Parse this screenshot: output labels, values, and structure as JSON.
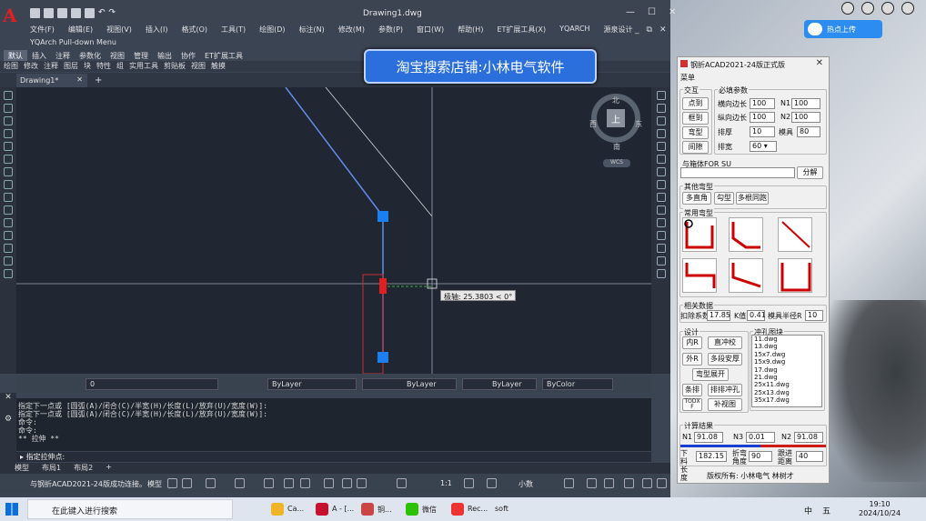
{
  "autocad": {
    "title": "Drawing1.dwg",
    "menus": [
      "文件(F)",
      "编辑(E)",
      "视图(V)",
      "插入(I)",
      "格式(O)",
      "工具(T)",
      "绘图(D)",
      "标注(N)",
      "修改(M)",
      "参数(P)",
      "窗口(W)",
      "帮助(H)",
      "ET扩展工具(X)",
      "YQARCH",
      "源泉设计"
    ],
    "yqarch_menu": "YQArch Pull-down Menu",
    "ribbon_tabs": [
      "默认",
      "插入",
      "注释",
      "参数化",
      "视图",
      "管理",
      "输出",
      "协作",
      "ET扩展工具"
    ],
    "ribbon_panel": [
      "绘图",
      "修改",
      "注释",
      "图层",
      "块",
      "特性",
      "组",
      "实用工具",
      "剪贴板",
      "视图",
      "触摸"
    ],
    "doc_tab": "Drawing1*",
    "promo": "淘宝搜索店铺:小林电气软件",
    "viewcube": {
      "n": "北",
      "s": "南",
      "w": "西",
      "e": "东",
      "top": "上",
      "wcs": "WCS"
    },
    "tooltip": "极轴: 25.3803 < 0°",
    "properties": {
      "layer": "0",
      "color": "ByLayer",
      "linetype": "ByLayer",
      "lineweight": "ByLayer",
      "plotstyle": "ByColor"
    },
    "command_history": [
      "指定下一点或 [圆弧(A)/闭合(C)/半宽(H)/长度(L)/放弃(U)/宽度(W)]:",
      "指定下一点或 [圆弧(A)/闭合(C)/半宽(H)/长度(L)/放弃(U)/宽度(W)]:",
      "命令:",
      "命令:",
      "** 拉伸 **"
    ],
    "command_input": "指定拉伸点:",
    "layout_tabs": [
      "模型",
      "布局1",
      "布局2",
      "+"
    ],
    "status_msg": "与钢折ACAD2021-24版成功连接。",
    "status_model": "模型",
    "status_scale": "1:1",
    "status_units": "小数"
  },
  "dialog": {
    "title": "钢折ACAD2021-24版正式版",
    "menu": "菜单",
    "g_interact": "交互",
    "btn_interact": [
      "点到",
      "框到",
      "弯型",
      "间隙"
    ],
    "g_params": "必填参数",
    "params": [
      {
        "label": "横向边长",
        "value": "100"
      },
      {
        "label": "纵向边长",
        "value": "100"
      },
      {
        "label": "排厚",
        "value": "10"
      },
      {
        "label": "排宽",
        "value": "60"
      }
    ],
    "n1_label": "N1",
    "n1": "100",
    "n2_label": "N2",
    "n2": "100",
    "die_label": "模具",
    "die": "80",
    "su_label": "与箱体FOR SU",
    "su_btn": "分解",
    "g_other": "其他弯型",
    "other_btns": [
      "多直角",
      "勾型",
      "多根同跑"
    ],
    "g_common": "常用弯型",
    "g_related": "相关数据",
    "deduct_label": "扣除系数",
    "deduct": "17.85",
    "k_label": "K值",
    "k": "0.41",
    "radius_label": "模具半径R",
    "radius": "10",
    "g_design": "设计",
    "g_punch": "冲孔图块",
    "design_btns": [
      "内R",
      "直冲校",
      "外R",
      "多段安厚",
      "弯型展开",
      "条排",
      "排排冲孔",
      "TODX F",
      "补视图"
    ],
    "punch_list": [
      "11.dwg",
      "13.dwg",
      "15x7.dwg",
      "15x9.dwg",
      "17.dwg",
      "21.dwg",
      "25x11.dwg",
      "25x13.dwg",
      "35x17.dwg"
    ],
    "g_calc": "计算结果",
    "calc_n1_label": "N1",
    "calc_n1": "91.08",
    "calc_n3_label": "N3",
    "calc_n3": "0.01",
    "calc_n2_label": "N2",
    "calc_n2": "91.08",
    "cut_label": "下料长度",
    "cut": "182.15",
    "bend_label": "折弯角度",
    "bend": "90",
    "feed_label": "跟进距离",
    "feed": "40",
    "copyright": "版权所有: 小林电气 林树才"
  },
  "desktop": {
    "upload": "热点上传"
  },
  "taskbar": {
    "search": "在此键入进行搜索",
    "apps": [
      "Ca...",
      "A - [...",
      "铜...",
      "微信",
      "Rec...",
      "soft"
    ],
    "ime1": "中",
    "ime2": "五",
    "time": "19:10",
    "date": "2024/10/24"
  }
}
